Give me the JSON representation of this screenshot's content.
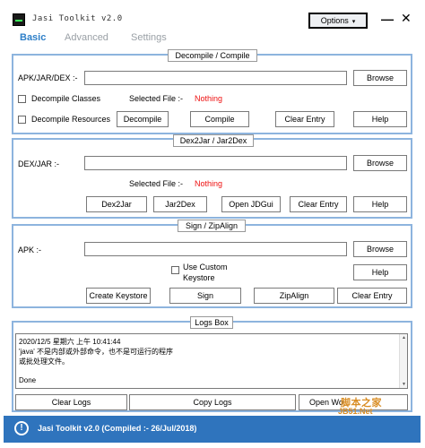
{
  "window": {
    "title": "Jasi Toolkit v2.0"
  },
  "header": {
    "options_label": "Options",
    "minimize": "—",
    "close": "✕"
  },
  "tabs": [
    {
      "label": "Basic"
    },
    {
      "label": "Advanced"
    },
    {
      "label": "Settings"
    }
  ],
  "decompile": {
    "title": "Decompile / Compile",
    "path_label": "APK/JAR/DEX :-",
    "path_value": "",
    "browse": "Browse",
    "chk_classes": "Decompile Classes",
    "chk_resources": "Decompile Resources",
    "selected_label": "Selected File :-",
    "selected_value": "Nothing",
    "btn_decompile": "Decompile",
    "btn_compile": "Compile",
    "btn_clear": "Clear Entry",
    "btn_help": "Help"
  },
  "dex2jar": {
    "title": "Dex2Jar / Jar2Dex",
    "path_label": "DEX/JAR :-",
    "path_value": "",
    "browse": "Browse",
    "selected_label": "Selected File :-",
    "selected_value": "Nothing",
    "btn_dex2jar": "Dex2Jar",
    "btn_jar2dex": "Jar2Dex",
    "btn_jdgui": "Open JDGui",
    "btn_clear": "Clear Entry",
    "btn_help": "Help"
  },
  "sign": {
    "title": "Sign / ZipAlign",
    "path_label": "APK :-",
    "path_value": "",
    "browse": "Browse",
    "chk_custom_line1": "Use Custom",
    "chk_custom_line2": "Keystore",
    "btn_help": "Help",
    "btn_create_keystore": "Create Keystore",
    "btn_sign": "Sign",
    "btn_zipalign": "ZipAlign",
    "btn_clear": "Clear Entry"
  },
  "logs": {
    "title": "Logs Box",
    "lines": [
      "2020/12/5 星期六 上午 10:41:44",
      "'java' 不是内部或外部命令，也不是可运行的程序",
      "或批处理文件。",
      "",
      "Done"
    ],
    "btn_clear": "Clear Logs",
    "btn_copy": "Copy Logs",
    "btn_open": "Open Wo"
  },
  "watermark": {
    "line1": "脚本之家",
    "line2": "JB51.Net"
  },
  "status": {
    "icon": "info-icon",
    "text": "Jasi Toolkit v2.0 (Compiled :- 26/Jul/2018)"
  },
  "colors": {
    "accent": "#2e7fc8",
    "status_bar": "#2f74bd",
    "card_border": "#8db4de",
    "alert": "#ee1111"
  }
}
